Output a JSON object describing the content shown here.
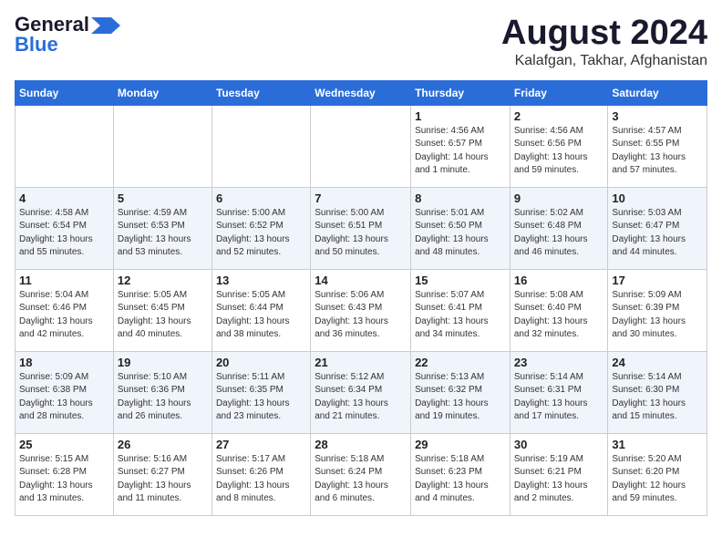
{
  "header": {
    "logo_general": "General",
    "logo_blue": "Blue",
    "month_title": "August 2024",
    "subtitle": "Kalafgan, Takhar, Afghanistan"
  },
  "weekdays": [
    "Sunday",
    "Monday",
    "Tuesday",
    "Wednesday",
    "Thursday",
    "Friday",
    "Saturday"
  ],
  "weeks": [
    [
      {
        "day": "",
        "info": ""
      },
      {
        "day": "",
        "info": ""
      },
      {
        "day": "",
        "info": ""
      },
      {
        "day": "",
        "info": ""
      },
      {
        "day": "1",
        "info": "Sunrise: 4:56 AM\nSunset: 6:57 PM\nDaylight: 14 hours\nand 1 minute."
      },
      {
        "day": "2",
        "info": "Sunrise: 4:56 AM\nSunset: 6:56 PM\nDaylight: 13 hours\nand 59 minutes."
      },
      {
        "day": "3",
        "info": "Sunrise: 4:57 AM\nSunset: 6:55 PM\nDaylight: 13 hours\nand 57 minutes."
      }
    ],
    [
      {
        "day": "4",
        "info": "Sunrise: 4:58 AM\nSunset: 6:54 PM\nDaylight: 13 hours\nand 55 minutes."
      },
      {
        "day": "5",
        "info": "Sunrise: 4:59 AM\nSunset: 6:53 PM\nDaylight: 13 hours\nand 53 minutes."
      },
      {
        "day": "6",
        "info": "Sunrise: 5:00 AM\nSunset: 6:52 PM\nDaylight: 13 hours\nand 52 minutes."
      },
      {
        "day": "7",
        "info": "Sunrise: 5:00 AM\nSunset: 6:51 PM\nDaylight: 13 hours\nand 50 minutes."
      },
      {
        "day": "8",
        "info": "Sunrise: 5:01 AM\nSunset: 6:50 PM\nDaylight: 13 hours\nand 48 minutes."
      },
      {
        "day": "9",
        "info": "Sunrise: 5:02 AM\nSunset: 6:48 PM\nDaylight: 13 hours\nand 46 minutes."
      },
      {
        "day": "10",
        "info": "Sunrise: 5:03 AM\nSunset: 6:47 PM\nDaylight: 13 hours\nand 44 minutes."
      }
    ],
    [
      {
        "day": "11",
        "info": "Sunrise: 5:04 AM\nSunset: 6:46 PM\nDaylight: 13 hours\nand 42 minutes."
      },
      {
        "day": "12",
        "info": "Sunrise: 5:05 AM\nSunset: 6:45 PM\nDaylight: 13 hours\nand 40 minutes."
      },
      {
        "day": "13",
        "info": "Sunrise: 5:05 AM\nSunset: 6:44 PM\nDaylight: 13 hours\nand 38 minutes."
      },
      {
        "day": "14",
        "info": "Sunrise: 5:06 AM\nSunset: 6:43 PM\nDaylight: 13 hours\nand 36 minutes."
      },
      {
        "day": "15",
        "info": "Sunrise: 5:07 AM\nSunset: 6:41 PM\nDaylight: 13 hours\nand 34 minutes."
      },
      {
        "day": "16",
        "info": "Sunrise: 5:08 AM\nSunset: 6:40 PM\nDaylight: 13 hours\nand 32 minutes."
      },
      {
        "day": "17",
        "info": "Sunrise: 5:09 AM\nSunset: 6:39 PM\nDaylight: 13 hours\nand 30 minutes."
      }
    ],
    [
      {
        "day": "18",
        "info": "Sunrise: 5:09 AM\nSunset: 6:38 PM\nDaylight: 13 hours\nand 28 minutes."
      },
      {
        "day": "19",
        "info": "Sunrise: 5:10 AM\nSunset: 6:36 PM\nDaylight: 13 hours\nand 26 minutes."
      },
      {
        "day": "20",
        "info": "Sunrise: 5:11 AM\nSunset: 6:35 PM\nDaylight: 13 hours\nand 23 minutes."
      },
      {
        "day": "21",
        "info": "Sunrise: 5:12 AM\nSunset: 6:34 PM\nDaylight: 13 hours\nand 21 minutes."
      },
      {
        "day": "22",
        "info": "Sunrise: 5:13 AM\nSunset: 6:32 PM\nDaylight: 13 hours\nand 19 minutes."
      },
      {
        "day": "23",
        "info": "Sunrise: 5:14 AM\nSunset: 6:31 PM\nDaylight: 13 hours\nand 17 minutes."
      },
      {
        "day": "24",
        "info": "Sunrise: 5:14 AM\nSunset: 6:30 PM\nDaylight: 13 hours\nand 15 minutes."
      }
    ],
    [
      {
        "day": "25",
        "info": "Sunrise: 5:15 AM\nSunset: 6:28 PM\nDaylight: 13 hours\nand 13 minutes."
      },
      {
        "day": "26",
        "info": "Sunrise: 5:16 AM\nSunset: 6:27 PM\nDaylight: 13 hours\nand 11 minutes."
      },
      {
        "day": "27",
        "info": "Sunrise: 5:17 AM\nSunset: 6:26 PM\nDaylight: 13 hours\nand 8 minutes."
      },
      {
        "day": "28",
        "info": "Sunrise: 5:18 AM\nSunset: 6:24 PM\nDaylight: 13 hours\nand 6 minutes."
      },
      {
        "day": "29",
        "info": "Sunrise: 5:18 AM\nSunset: 6:23 PM\nDaylight: 13 hours\nand 4 minutes."
      },
      {
        "day": "30",
        "info": "Sunrise: 5:19 AM\nSunset: 6:21 PM\nDaylight: 13 hours\nand 2 minutes."
      },
      {
        "day": "31",
        "info": "Sunrise: 5:20 AM\nSunset: 6:20 PM\nDaylight: 12 hours\nand 59 minutes."
      }
    ]
  ]
}
